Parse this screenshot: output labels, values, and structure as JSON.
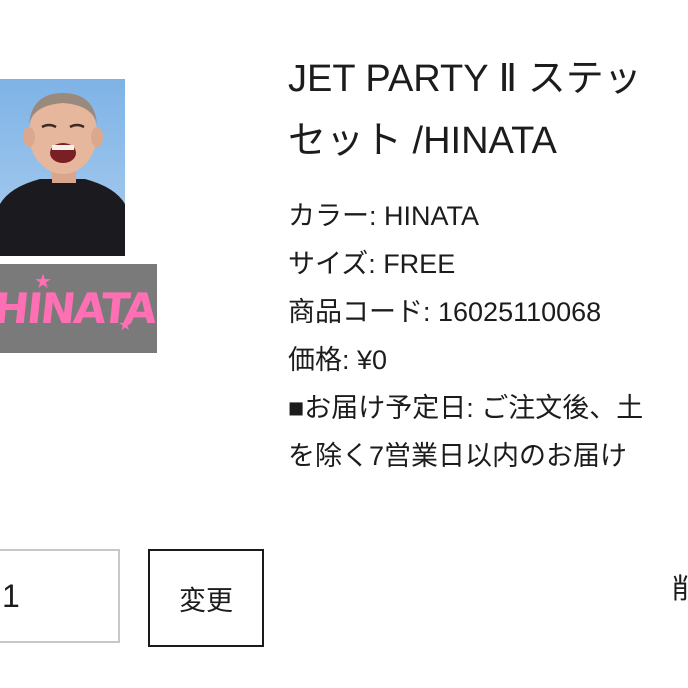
{
  "product": {
    "title_line1": "JET PARTY Ⅱ ステッ",
    "title_line2": "セット /HINATA",
    "name_tag_text": "HINATA"
  },
  "details": {
    "color": "カラー: HINATA",
    "size": "サイズ: FREE",
    "product_code": "商品コード: 16025110068",
    "price": "価格: ¥0",
    "delivery_line1": "■お届け予定日: ご注文後、土",
    "delivery_line2": "を除く7営業日以内のお届け"
  },
  "cart": {
    "quantity_value": "1",
    "change_label": "変更",
    "delete_label": "削"
  },
  "colors": {
    "photo_bg": "#7fb3e6",
    "tag_bg": "#7a7a7a",
    "tag_text": "#ff6fb4",
    "text": "#1c1c1c"
  },
  "icons": [
    "person-photo",
    "star-icon"
  ]
}
